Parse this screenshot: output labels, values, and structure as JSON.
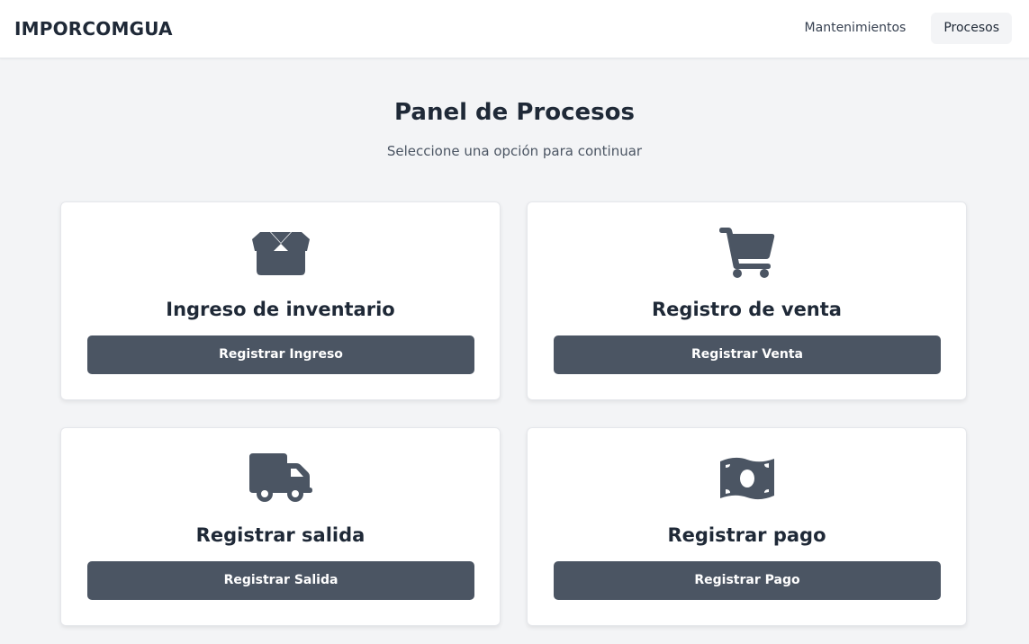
{
  "navbar": {
    "brand": "IMPORCOMGUA",
    "links": [
      {
        "label": "Mantenimientos",
        "active": false
      },
      {
        "label": "Procesos",
        "active": true
      }
    ]
  },
  "main": {
    "title": "Panel de Procesos",
    "subtitle": "Seleccione una opción para continuar",
    "cards": [
      {
        "icon": "box-icon",
        "title": "Ingreso de inventario",
        "button_label": "Registrar Ingreso"
      },
      {
        "icon": "shopping-cart-icon",
        "title": "Registro de venta",
        "button_label": "Registrar Venta"
      },
      {
        "icon": "truck-icon",
        "title": "Registrar salida",
        "button_label": "Registrar Salida"
      },
      {
        "icon": "money-bill-icon",
        "title": "Registrar pago",
        "button_label": "Registrar Pago"
      }
    ]
  },
  "colors": {
    "icon": "#4b5563",
    "button": "#4b5563",
    "background": "#f3f4f6"
  }
}
